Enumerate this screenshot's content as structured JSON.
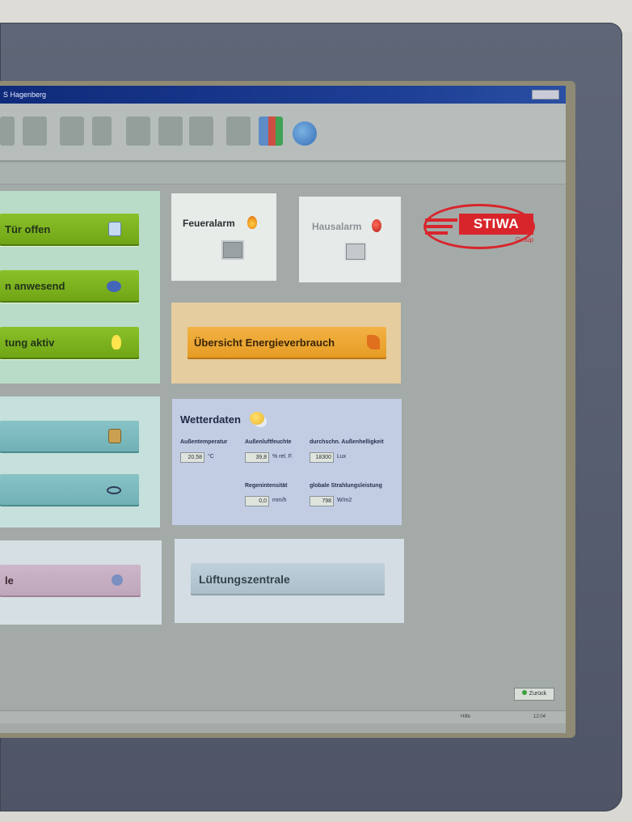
{
  "window": {
    "title": "S Hagenberg"
  },
  "toolbar": {
    "icons": [
      "camera-icon",
      "network-icon",
      "list-icon",
      "filter-icon",
      "save-icon",
      "copy-icon",
      "bucket-icon",
      "settings-icon",
      "multi-window-icon",
      "internet-icon"
    ]
  },
  "panels": {
    "status": {
      "door_open": "Tür offen",
      "present": "n anwesend",
      "light_active": "tung aktiv"
    },
    "pink": {
      "label": "le"
    },
    "alarms": {
      "fire": "Feueralarm",
      "house": "Hausalarm"
    },
    "energy": {
      "button": "Übersicht Energieverbrauch"
    },
    "weather": {
      "title": "Wetterdaten",
      "fields": [
        {
          "label": "Außentemperatur",
          "value": "20,58",
          "unit": "°C"
        },
        {
          "label": "Außenluftfeuchte",
          "value": "39,8",
          "unit": "% rel. F."
        },
        {
          "label": "durchschn. Außenhelligkeit",
          "value": "18300",
          "unit": "Lux"
        },
        {
          "label": "Regenintensität",
          "value": "0,0",
          "unit": "mm/h"
        },
        {
          "label": "globale Strahlungsleistung",
          "value": "798",
          "unit": "W/m2"
        }
      ]
    },
    "ventilation": {
      "button": "Lüftungszentrale"
    }
  },
  "logo": {
    "brand": "STIWA",
    "group": "Group"
  },
  "footer": {
    "button": "Zurück",
    "status_left": "Hilfe",
    "status_right": "12:04"
  },
  "colors": {
    "accent_green": "#7ab31c",
    "accent_orange": "#e9a12c",
    "brand_red": "#d8252b"
  }
}
